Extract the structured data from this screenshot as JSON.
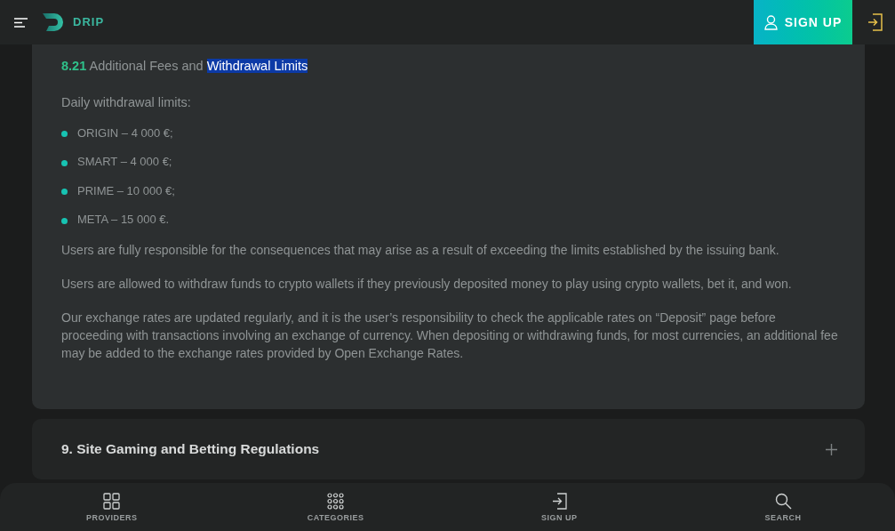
{
  "header": {
    "logo": "DRIP",
    "signup_button": "SIGN UP"
  },
  "section": {
    "heading": {
      "number": "8.21",
      "text": "Additional Fees and",
      "highlighted": "Withdrawal Limits"
    },
    "intro": "Daily withdrawal limits:",
    "limits": [
      "ORIGIN – 4 000 €;",
      "SMART – 4 000 €;",
      "PRIME – 10 000 €;",
      "META – 15 000 €."
    ],
    "paragraphs": [
      "Users are fully responsible for the consequences that may arise as a result of exceeding the limits established by the issuing bank.",
      "Users are allowed to withdraw funds to crypto wallets if they previously deposited money to play using crypto wallets, bet it, and won.",
      "Our exchange rates are updated regularly, and it is the user’s responsibility to check the applicable rates on “Deposit” page before proceeding with transactions involving an exchange of currency. When depositing or withdrawing funds, for most currencies, an additional fee may be added to the exchange rates provided by Open Exchange Rates."
    ]
  },
  "accordion": [
    {
      "title": "9. Site Gaming and Betting Regulations",
      "expanded": false
    }
  ],
  "bottom_nav": [
    {
      "kind": "providers",
      "label": "PROVIDERS"
    },
    {
      "kind": "categories",
      "label": "CATEGORIES"
    },
    {
      "kind": "signup",
      "label": "SIGN UP"
    },
    {
      "kind": "search",
      "label": "SEARCH"
    }
  ]
}
